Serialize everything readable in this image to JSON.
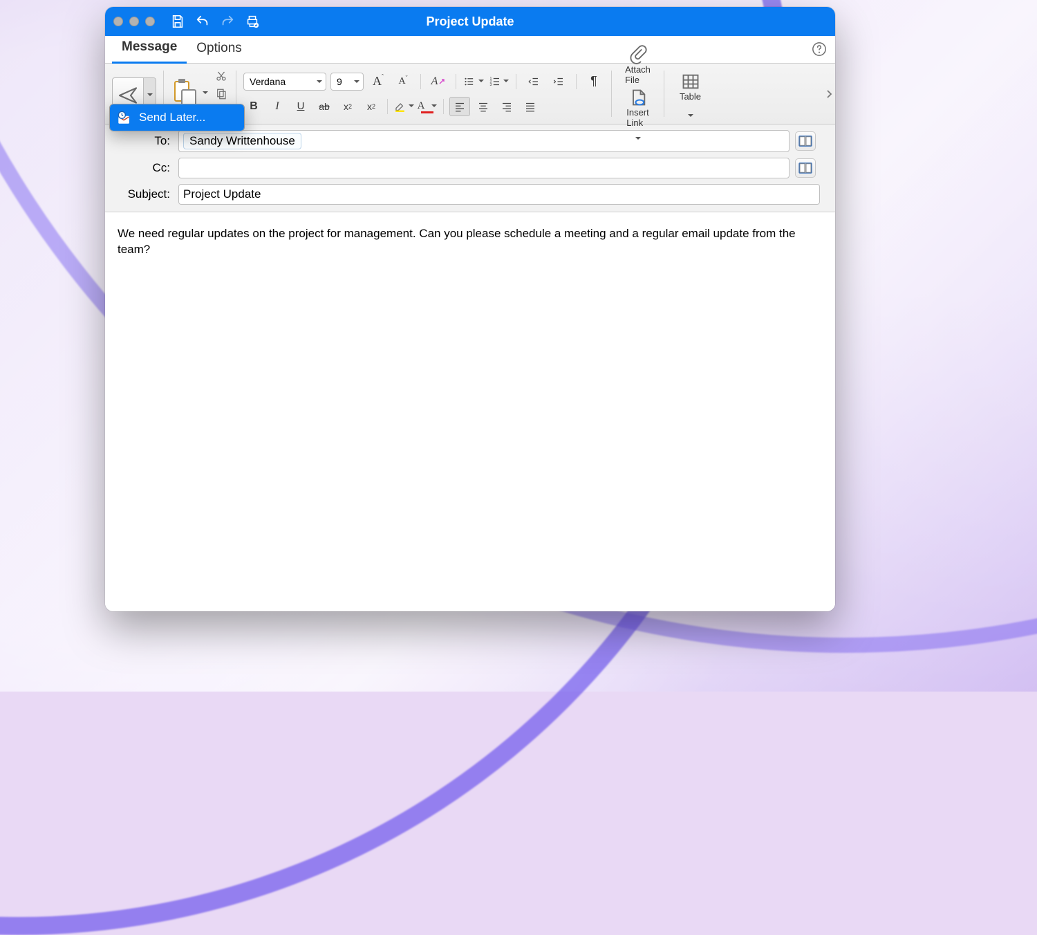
{
  "window": {
    "title": "Project Update"
  },
  "tabs": {
    "message": "Message",
    "options": "Options"
  },
  "popup": {
    "send_later": "Send Later..."
  },
  "font": {
    "name": "Verdana",
    "size": "9"
  },
  "headers": {
    "to_label": "To:",
    "cc_label": "Cc:",
    "subject_label": "Subject:",
    "to_recipient": "Sandy Writtenhouse",
    "subject_value": "Project Update"
  },
  "ribbon": {
    "attach_file": "Attach\nFile",
    "insert_link": "Insert\nLink",
    "table": "Table"
  },
  "body": "We need regular updates on the project for management. Can you please schedule a meeting and a regular email update from the team?"
}
